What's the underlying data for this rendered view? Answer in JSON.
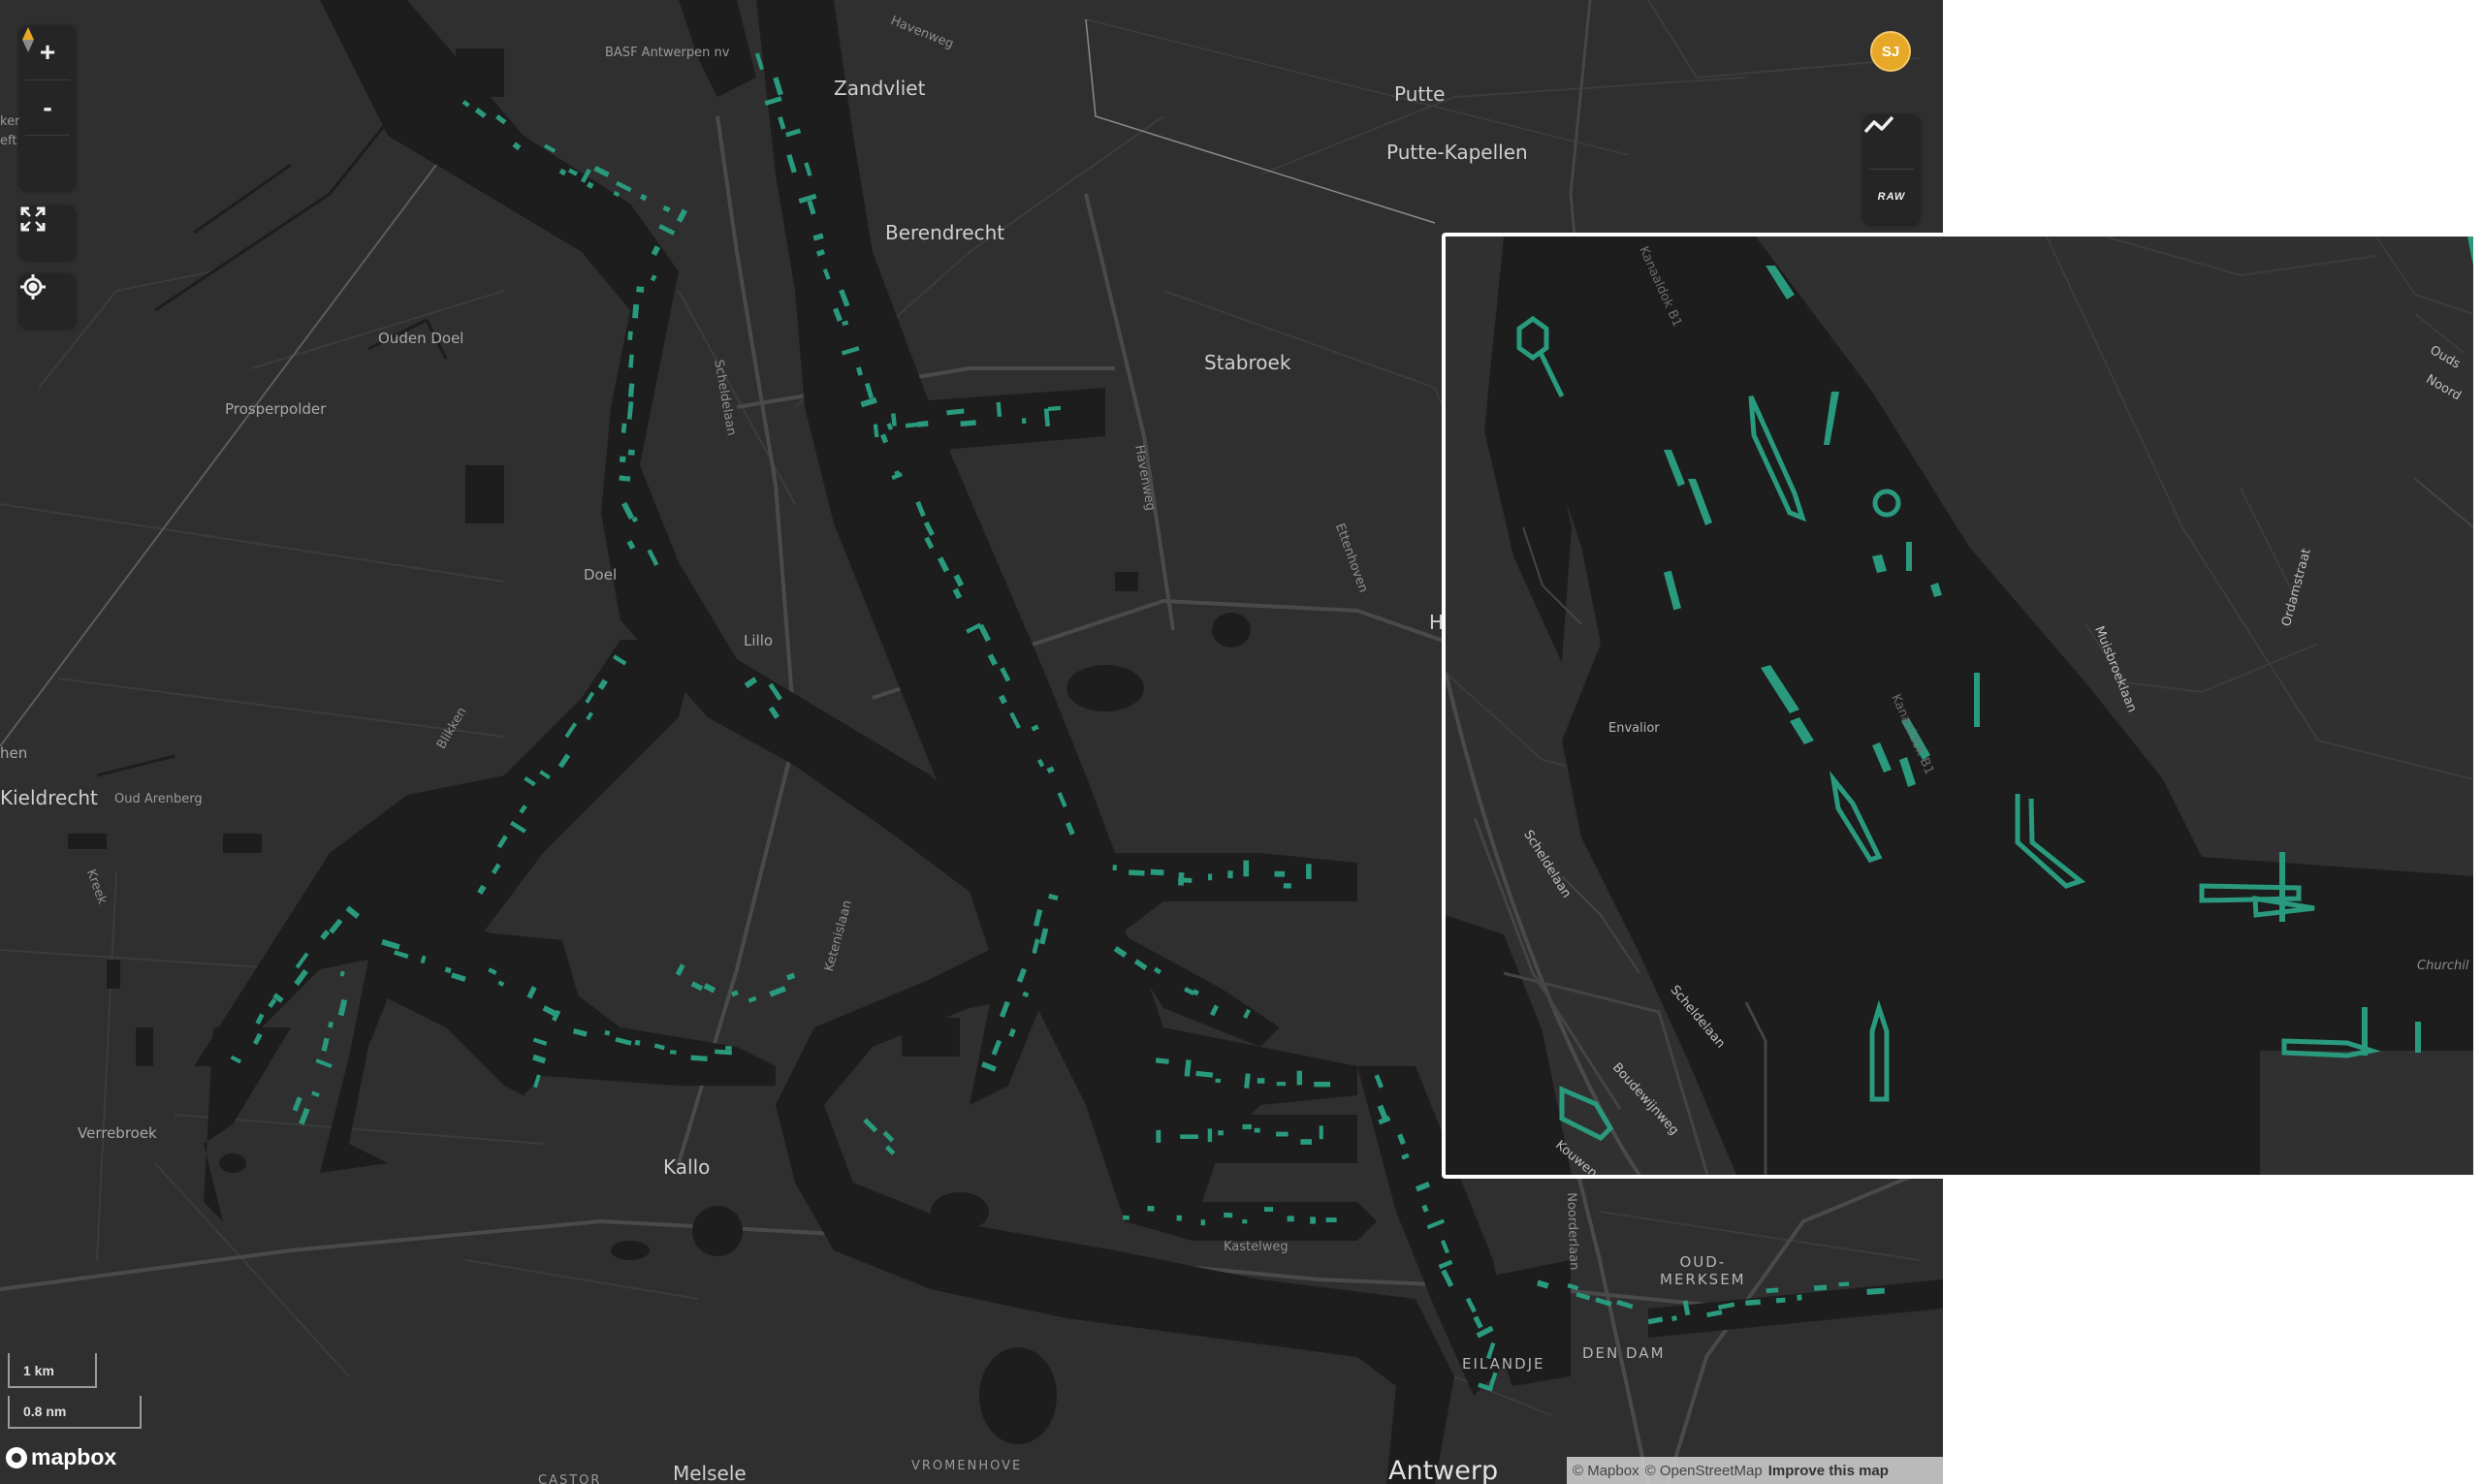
{
  "map": {
    "place_labels": {
      "zandvliet": "Zandvliet",
      "putte": "Putte",
      "putte_kapellen": "Putte-Kapellen",
      "berendrecht": "Berendrecht",
      "stabroek": "Stabroek",
      "ouden_doel": "Ouden Doel",
      "prosperpolder": "Prosperpolder",
      "doel": "Doel",
      "lillo": "Lillo",
      "kieldrecht": "Kieldrecht",
      "oud_arenberg": "Oud Arenberg",
      "verrebroek": "Verrebroek",
      "kallo": "Kallo",
      "oud_merksem": "OUD-\nMERKSEM",
      "eilandje": "EILANDJE",
      "den_dam": "DEN DAM",
      "antwerp": "Antwerp",
      "melsele": "Melsele",
      "vromenhove": "VROMENHOVE",
      "castor": "CASTOR",
      "basf": "BASF Antwerpen nv",
      "hen": "hen",
      "ker": "ker",
      "eft": "eft",
      "h": "H"
    },
    "street_labels": {
      "havenweg": "Havenweg",
      "scheldelaan": "Scheldelaan",
      "havenweg2": "Havenweg",
      "ettenhoven": "Ettenhoven",
      "blikken": "Blikken",
      "kreek": "Kreek",
      "ketenislaan": "Ketenislaan",
      "kastelweg": "Kastelweg",
      "noorderlaan": "Noorderlaan"
    }
  },
  "controls": {
    "zoom_in": "+",
    "zoom_out": "-",
    "compass_icon": "compass-icon",
    "fullscreen_icon": "fullscreen-icon",
    "locate_icon": "locate-icon",
    "avatar_initials": "SJ",
    "chart_icon": "trend-chart-icon",
    "raw_label": "RAW"
  },
  "scale": {
    "metric": "1 km",
    "nautical": "0.8 nm"
  },
  "attribution": {
    "mapbox": "© Mapbox",
    "osm": "© OpenStreetMap",
    "improve": "Improve this map"
  },
  "logo": "mapbox",
  "inset": {
    "labels": {
      "kanaaldok_b1": "Kanaaldok B1",
      "kanaaldok_b1_2": "Kanaaldok B1",
      "envalior": "Envalior",
      "scheldelaan_a": "Scheldelaan",
      "scheldelaan_b": "Scheldelaan",
      "boudewijnweg": "Boudewijnweg",
      "kouwen": "Kouwen",
      "ordamstraat": "Ordamstraat",
      "muisbroeklaan": "Muisbroeklaan",
      "churchill": "Churchil",
      "ouds": "Ouds",
      "noord": "Noord"
    }
  },
  "colors": {
    "land": "#2f2f2f",
    "water": "#1c1d1c",
    "vessel": "#2a9a7e",
    "road": "#474747",
    "accent": "#e6a826"
  }
}
